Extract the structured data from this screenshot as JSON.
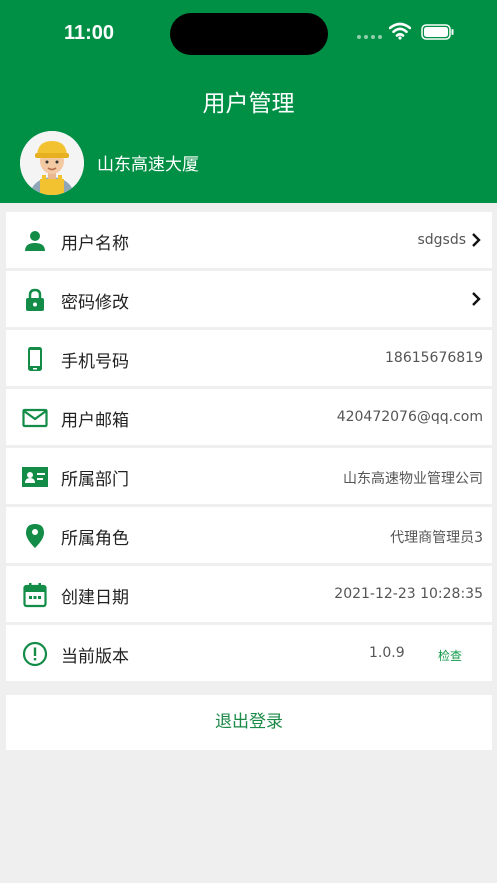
{
  "status_bar": {
    "time": "11:00"
  },
  "header": {
    "title": "用户管理",
    "org_name": "山东高速大厦"
  },
  "rows": [
    {
      "icon": "person-icon",
      "label": "用户名称",
      "value": "sdgsds"
    },
    {
      "icon": "lock-icon",
      "label": "密码修改",
      "value": ""
    },
    {
      "icon": "phone-icon",
      "label": "手机号码",
      "value": "18615676819"
    },
    {
      "icon": "mail-icon",
      "label": "用户邮箱",
      "value": "420472076@qq.com"
    },
    {
      "icon": "id-card-icon",
      "label": "所属部门",
      "value": "山东高速物业管理公司"
    },
    {
      "icon": "location-pin-icon",
      "label": "所属角色",
      "value": "代理商管理员3"
    },
    {
      "icon": "calendar-icon",
      "label": "创建日期",
      "value": "2021-12-23 10:28:35"
    },
    {
      "icon": "info-icon",
      "label": "当前版本",
      "value": "1.0.9",
      "action": "检查"
    }
  ],
  "logout_label": "退出登录",
  "colors": {
    "primary": "#009045",
    "background": "#efefef",
    "icon": "#128c47"
  }
}
